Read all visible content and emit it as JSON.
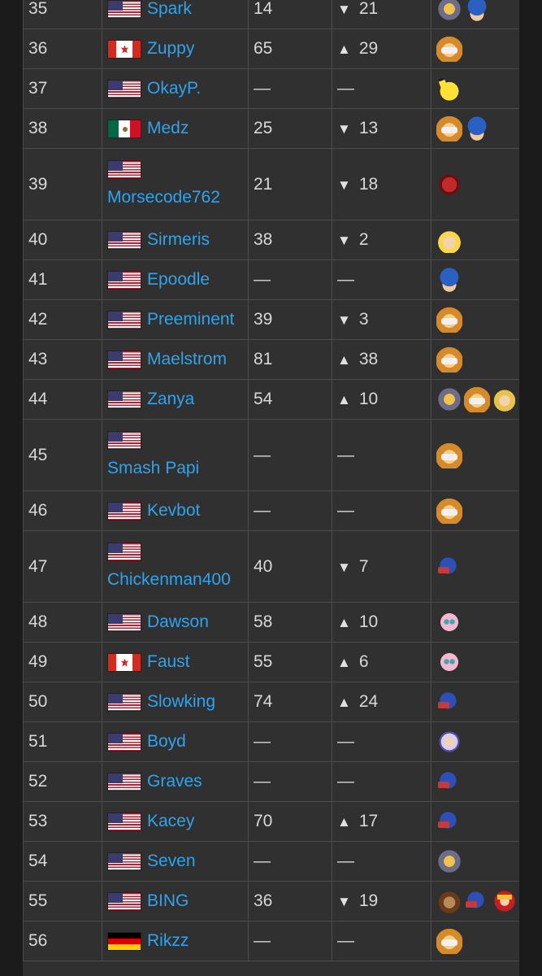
{
  "rows": [
    {
      "rank": "35",
      "flag": "us",
      "name": "Spark",
      "prev": "14",
      "dir": "down",
      "change": "21",
      "chars": [
        "sheik",
        "marth"
      ]
    },
    {
      "rank": "36",
      "flag": "ca",
      "name": "Zuppy",
      "prev": "65",
      "dir": "up",
      "change": "29",
      "chars": [
        "fox"
      ]
    },
    {
      "rank": "37",
      "flag": "us",
      "name": "OkayP.",
      "prev": "—",
      "dir": "",
      "change": "—",
      "chars": [
        "pikachu"
      ]
    },
    {
      "rank": "38",
      "flag": "mx",
      "name": "Medz",
      "prev": "25",
      "dir": "down",
      "change": "13",
      "chars": [
        "fox",
        "marth"
      ]
    },
    {
      "rank": "39",
      "flag": "us",
      "name": "Morsecode762",
      "prev": "21",
      "dir": "down",
      "change": "18",
      "chars": [
        "samus"
      ],
      "wrap": true
    },
    {
      "rank": "40",
      "flag": "us",
      "name": "Sirmeris",
      "prev": "38",
      "dir": "down",
      "change": "2",
      "chars": [
        "peach"
      ]
    },
    {
      "rank": "41",
      "flag": "us",
      "name": "Epoodle",
      "prev": "—",
      "dir": "",
      "change": "—",
      "chars": [
        "marth"
      ]
    },
    {
      "rank": "42",
      "flag": "us",
      "name": "Preeminent",
      "prev": "39",
      "dir": "down",
      "change": "3",
      "chars": [
        "fox"
      ]
    },
    {
      "rank": "43",
      "flag": "us",
      "name": "Maelstrom",
      "prev": "81",
      "dir": "up",
      "change": "38",
      "chars": [
        "fox"
      ]
    },
    {
      "rank": "44",
      "flag": "us",
      "name": "Zanya",
      "prev": "54",
      "dir": "up",
      "change": "10",
      "chars": [
        "sheik",
        "fox",
        "zelda"
      ]
    },
    {
      "rank": "45",
      "flag": "us",
      "name": "Smash Papi",
      "prev": "—",
      "dir": "",
      "change": "—",
      "chars": [
        "fox"
      ],
      "wrap": true
    },
    {
      "rank": "46",
      "flag": "us",
      "name": "Kevbot",
      "prev": "—",
      "dir": "",
      "change": "—",
      "chars": [
        "fox"
      ]
    },
    {
      "rank": "47",
      "flag": "us",
      "name": "Chickenman400",
      "prev": "40",
      "dir": "down",
      "change": "7",
      "chars": [
        "falco"
      ],
      "wrap": true
    },
    {
      "rank": "48",
      "flag": "us",
      "name": "Dawson",
      "prev": "58",
      "dir": "up",
      "change": "10",
      "chars": [
        "puff"
      ]
    },
    {
      "rank": "49",
      "flag": "ca",
      "name": "Faust",
      "prev": "55",
      "dir": "up",
      "change": "6",
      "chars": [
        "puff"
      ]
    },
    {
      "rank": "50",
      "flag": "us",
      "name": "Slowking",
      "prev": "74",
      "dir": "up",
      "change": "24",
      "chars": [
        "falco"
      ]
    },
    {
      "rank": "51",
      "flag": "us",
      "name": "Boyd",
      "prev": "—",
      "dir": "",
      "change": "—",
      "chars": [
        "ics"
      ]
    },
    {
      "rank": "52",
      "flag": "us",
      "name": "Graves",
      "prev": "—",
      "dir": "",
      "change": "—",
      "chars": [
        "falco"
      ]
    },
    {
      "rank": "53",
      "flag": "us",
      "name": "Kacey",
      "prev": "70",
      "dir": "up",
      "change": "17",
      "chars": [
        "falco"
      ]
    },
    {
      "rank": "54",
      "flag": "us",
      "name": "Seven",
      "prev": "—",
      "dir": "",
      "change": "—",
      "chars": [
        "sheik"
      ]
    },
    {
      "rank": "55",
      "flag": "us",
      "name": "BING",
      "prev": "36",
      "dir": "down",
      "change": "19",
      "chars": [
        "dk",
        "falco",
        "falcon"
      ]
    },
    {
      "rank": "56",
      "flag": "de",
      "name": "Rikzz",
      "prev": "—",
      "dir": "",
      "change": "—",
      "chars": [
        "fox"
      ]
    }
  ],
  "arrows": {
    "up": "▲",
    "down": "▼"
  }
}
